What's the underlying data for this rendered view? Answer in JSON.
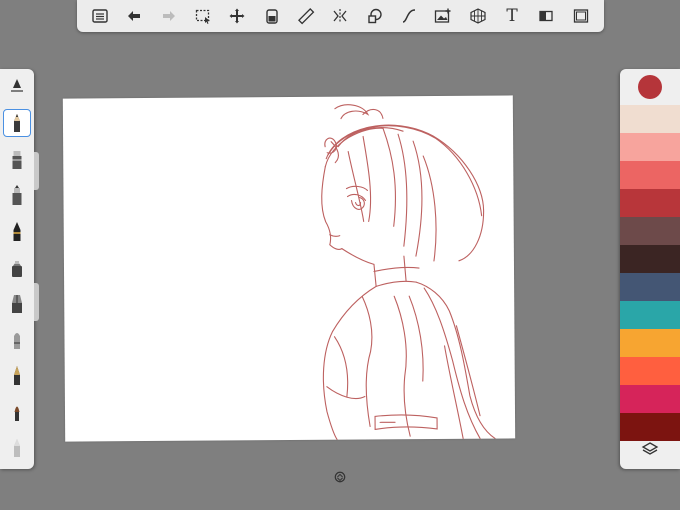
{
  "toolbar": {
    "buttons": [
      {
        "name": "menu-icon"
      },
      {
        "name": "undo-icon"
      },
      {
        "name": "redo-icon"
      },
      {
        "name": "selection-icon"
      },
      {
        "name": "transform-icon"
      },
      {
        "name": "fill-icon"
      },
      {
        "name": "ruler-icon"
      },
      {
        "name": "symmetry-icon"
      },
      {
        "name": "shapes-icon"
      },
      {
        "name": "curve-icon"
      },
      {
        "name": "image-icon"
      },
      {
        "name": "perspective-icon"
      },
      {
        "name": "text-icon"
      },
      {
        "name": "layer-mode-icon"
      },
      {
        "name": "canvas-icon"
      }
    ],
    "text_label": "T"
  },
  "brushes": {
    "items": [
      {
        "name": "brush-settings-icon"
      },
      {
        "name": "pencil-brush-icon",
        "selected": true
      },
      {
        "name": "marker-brush-icon"
      },
      {
        "name": "felt-tip-brush-icon"
      },
      {
        "name": "ink-pen-brush-icon"
      },
      {
        "name": "fill-brush-icon"
      },
      {
        "name": "paint-brush-icon"
      },
      {
        "name": "airbrush-icon"
      },
      {
        "name": "calligraphy-brush-icon"
      },
      {
        "name": "paintbrush-icon"
      },
      {
        "name": "eraser-brush-icon"
      }
    ]
  },
  "colors": {
    "current": "#b5353a",
    "swatches": [
      "#f0ddd0",
      "#f7a49d",
      "#ec6563",
      "#b8363a",
      "#6d4a4a",
      "#3b2523",
      "#445674",
      "#2aa6a8",
      "#f7a531",
      "#ff5f3f",
      "#d6245a",
      "#7c1410"
    ]
  },
  "canvas": {
    "stroke_color": "#b6504f"
  }
}
